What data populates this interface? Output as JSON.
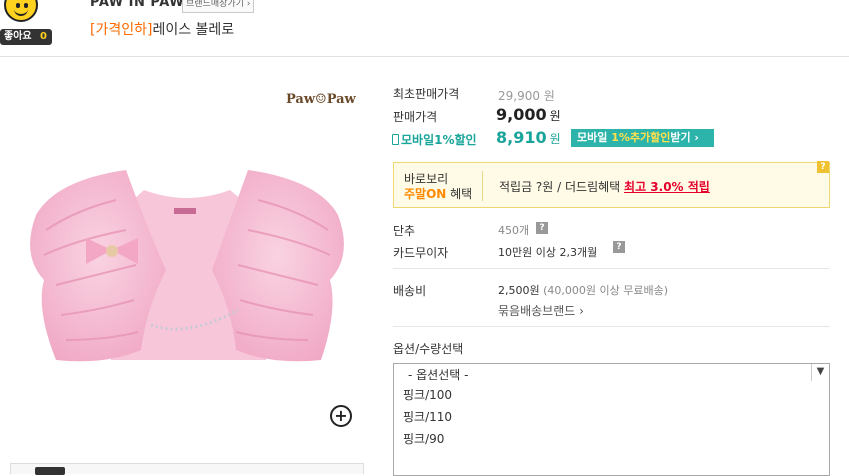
{
  "header": {
    "like_label": "좋아요",
    "like_count": "0",
    "brand_name": "PAW IN PAW",
    "brand_shop_button": "브랜드매장가기 ›",
    "title_tag": "[가격인하]",
    "title_text": "레이스 볼레로"
  },
  "gallery": {
    "brand_logo": "Paw☺Paw"
  },
  "price": {
    "original_label": "최초판매가격",
    "original_value": "29,900 원",
    "sale_label": "판매가격",
    "sale_value": "9,000",
    "sale_unit": "원",
    "mobile_label": "모바일1%할인",
    "mobile_value": "8,910",
    "mobile_unit": "원",
    "mobile_button_pre": "모바일 ",
    "mobile_button_hl": "1%추가할인",
    "mobile_button_post": "받기 ›"
  },
  "benefit": {
    "line1": "바로보리",
    "line2_on": "주말ON",
    "line2_rest": " 혜택",
    "points_text": "적립금 ?원 / 더드림혜택 ",
    "points_highlight": "최고 3.0% 적립",
    "help": "?"
  },
  "info": {
    "rows": [
      {
        "label": "단추",
        "value": "450개"
      },
      {
        "label": "카드무이자",
        "value": "10만원 이상 2,3개월"
      }
    ],
    "shipping_label": "배송비",
    "shipping_value": "2,500원",
    "shipping_note": "(40,000원 이상 무료배송)",
    "bundle_link": "묶음배송브랜드 ›"
  },
  "options": {
    "label": "옵션/수량선택",
    "placeholder": "- 옵션선택 -",
    "items": [
      "핑크/100",
      "핑크/110",
      "핑크/90"
    ]
  },
  "colors": {
    "teal": "#2cb3aa",
    "orange": "#ff6a00",
    "red": "#e6002d"
  }
}
